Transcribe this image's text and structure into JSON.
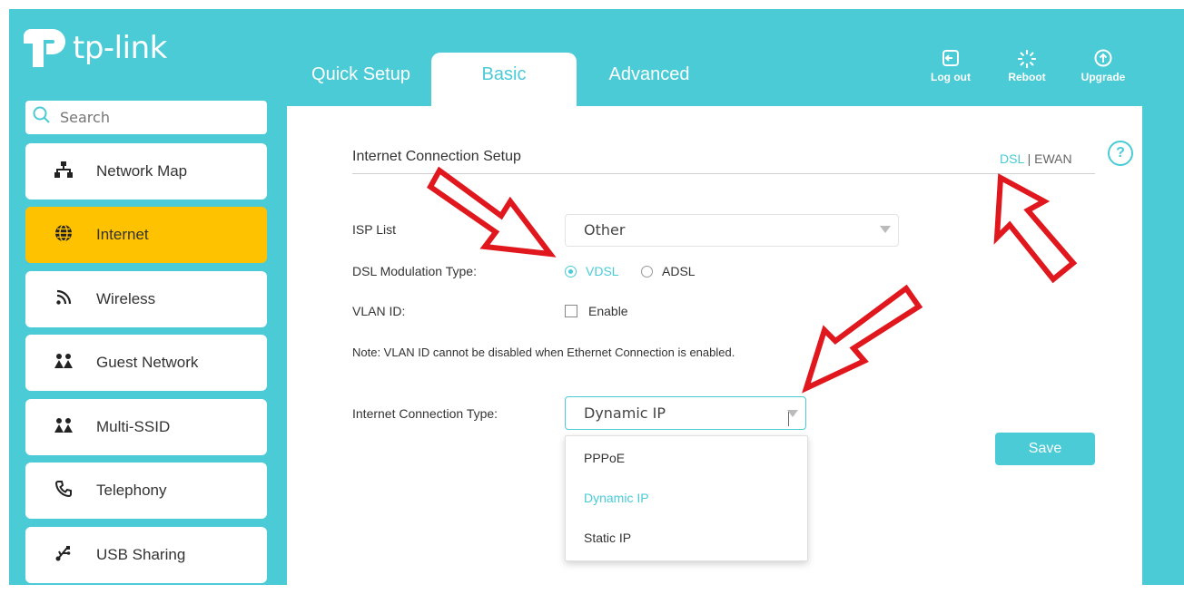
{
  "brand": {
    "name": "tp-link",
    "accent": "#4acbd6",
    "active_nav": "#ffc200"
  },
  "tabs": [
    {
      "label": "Quick Setup"
    },
    {
      "label": "Basic"
    },
    {
      "label": "Advanced"
    }
  ],
  "top_actions": [
    {
      "label": "Log out",
      "icon": "logout-icon"
    },
    {
      "label": "Reboot",
      "icon": "reboot-icon"
    },
    {
      "label": "Upgrade",
      "icon": "upgrade-icon"
    }
  ],
  "search": {
    "placeholder": "Search"
  },
  "sidebar": {
    "items": [
      {
        "label": "Network Map",
        "icon": "network-map-icon"
      },
      {
        "label": "Internet",
        "icon": "globe-icon"
      },
      {
        "label": "Wireless",
        "icon": "wireless-icon"
      },
      {
        "label": "Guest Network",
        "icon": "guest-network-icon"
      },
      {
        "label": "Multi-SSID",
        "icon": "multi-ssid-icon"
      },
      {
        "label": "Telephony",
        "icon": "phone-icon"
      },
      {
        "label": "USB Sharing",
        "icon": "usb-icon"
      }
    ]
  },
  "panel": {
    "title": "Internet Connection Setup",
    "mode_dsl": "DSL",
    "mode_sep": "|",
    "mode_ewan": "EWAN",
    "isp_label": "ISP List",
    "isp_value": "Other",
    "modulation_label": "DSL Modulation Type:",
    "modulation_vdsl": "VDSL",
    "modulation_adsl": "ADSL",
    "vlan_label": "VLAN ID:",
    "vlan_enable": "Enable",
    "note": "Note: VLAN ID cannot be disabled when Ethernet Connection is enabled.",
    "conn_type_label": "Internet Connection Type:",
    "conn_type_value": "Dynamic IP",
    "options": [
      "PPPoE",
      "Dynamic IP",
      "Static IP"
    ],
    "save_label": "Save"
  }
}
